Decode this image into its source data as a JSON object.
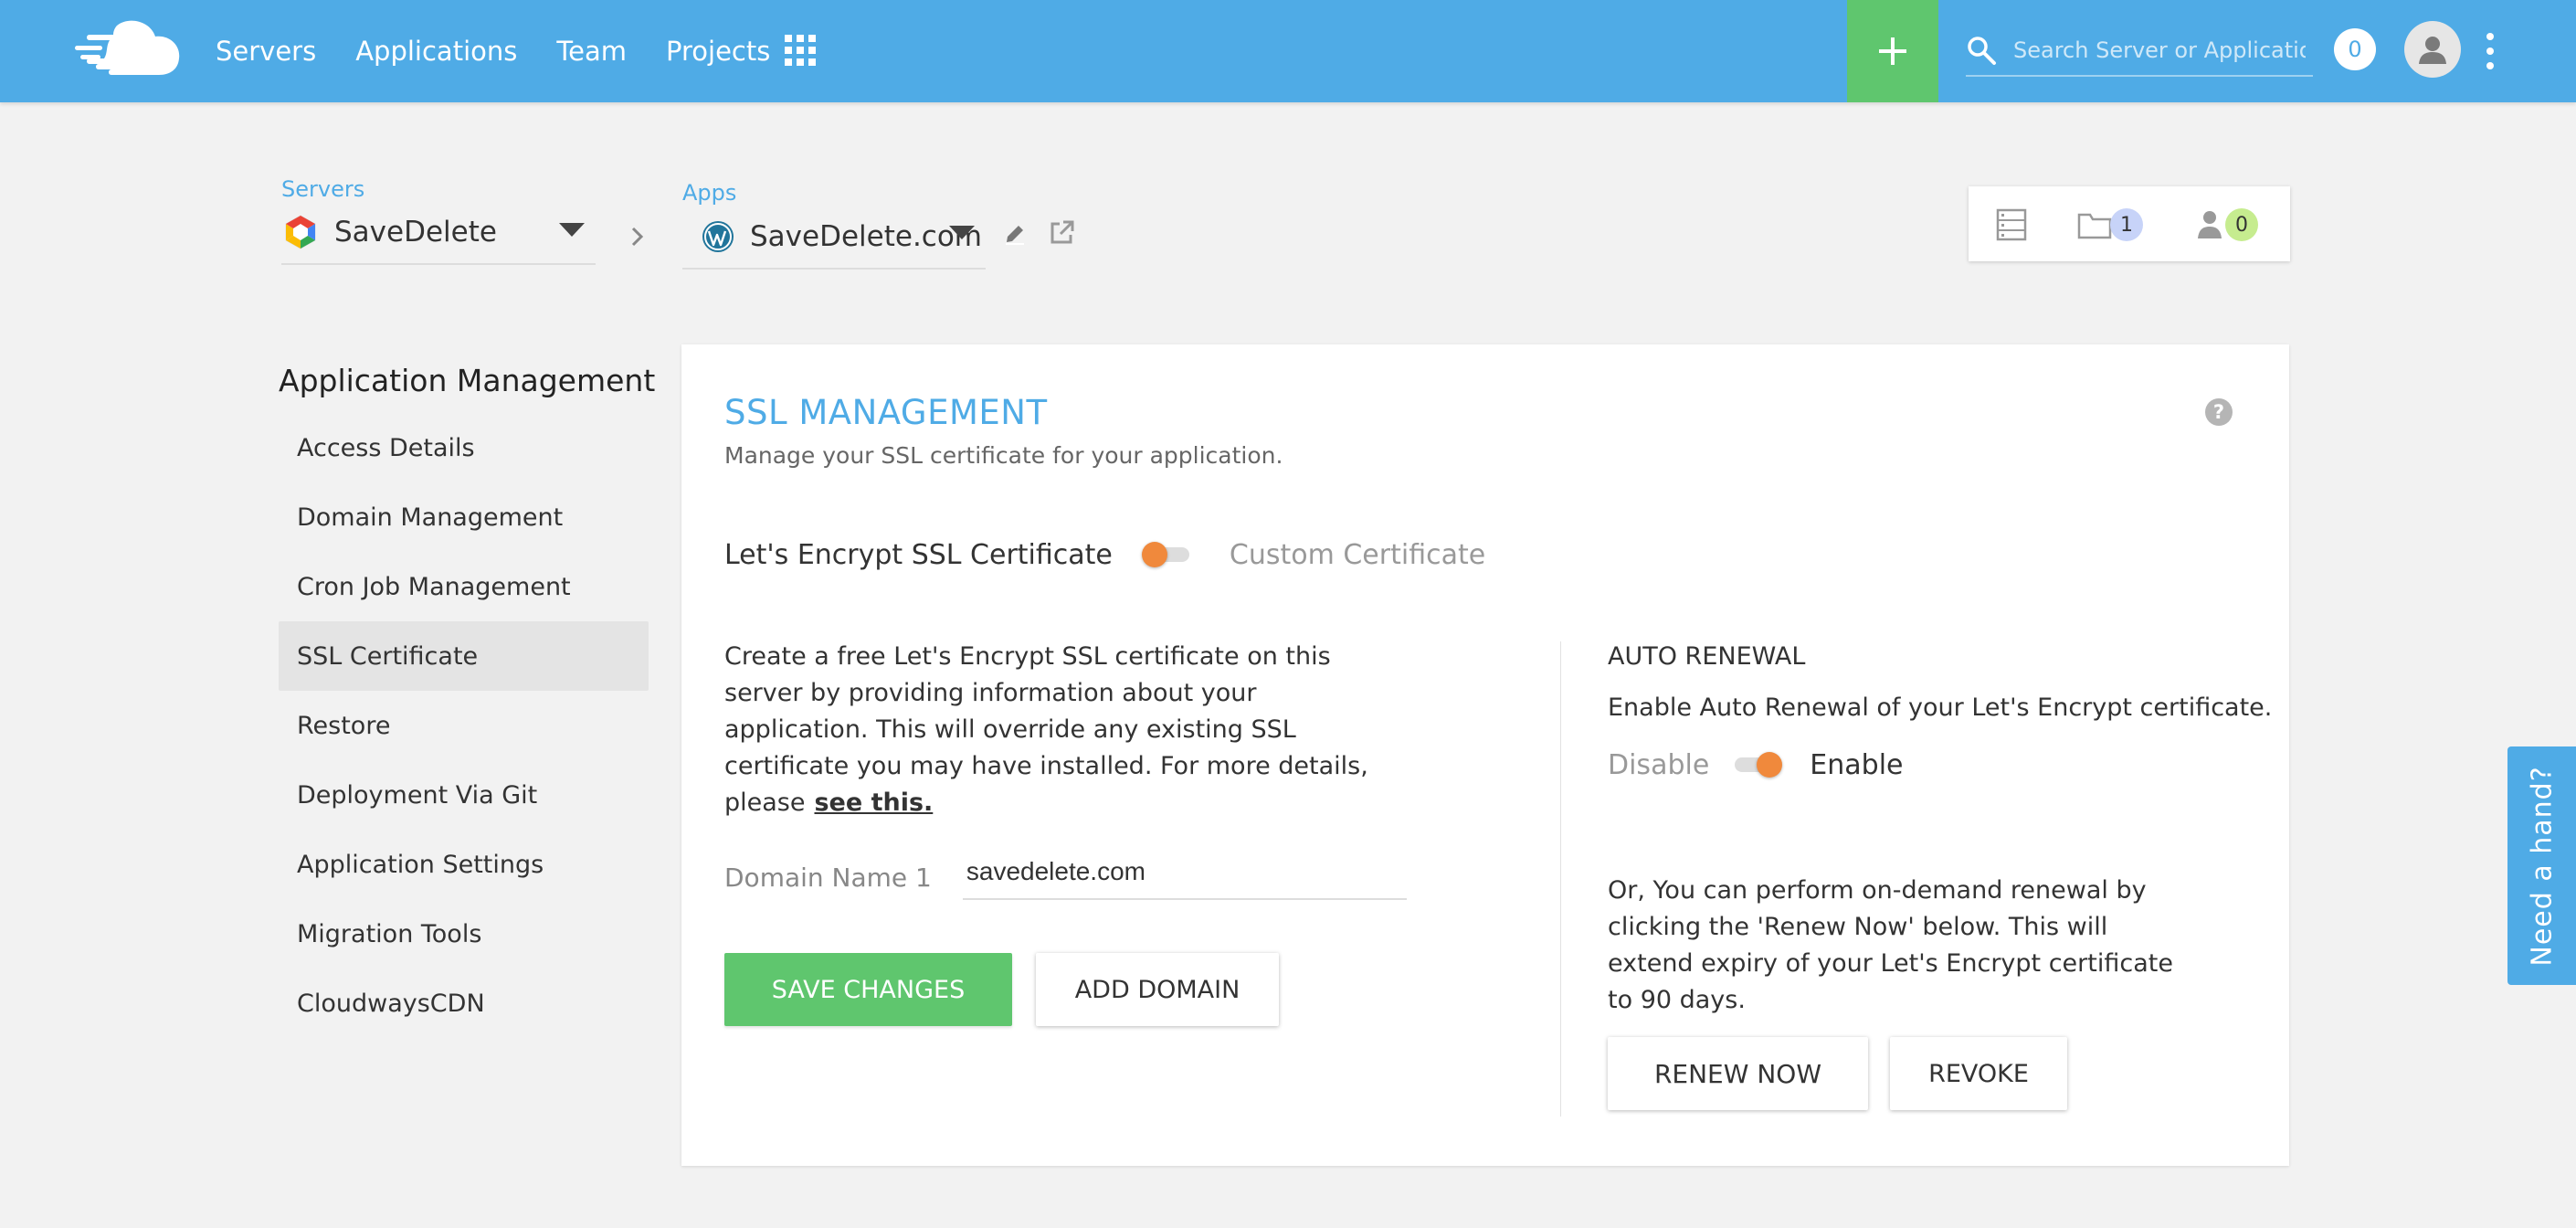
{
  "topbar": {
    "nav": [
      "Servers",
      "Applications",
      "Team",
      "Projects"
    ],
    "search_placeholder": "Search Server or Application",
    "notifications_count": "0"
  },
  "breadcrumb": {
    "servers_label": "Servers",
    "server_name": "SaveDelete",
    "apps_label": "Apps",
    "app_name": "SaveDelete.com"
  },
  "stats": {
    "folders_count": "1",
    "members_count": "0",
    "folders_color": "#c7d3f8",
    "members_color": "#c6ec8f"
  },
  "menu": {
    "title": "Application Management",
    "items": [
      "Access Details",
      "Domain Management",
      "Cron Job Management",
      "SSL Certificate",
      "Restore",
      "Deployment Via Git",
      "Application Settings",
      "Migration Tools",
      "CloudwaysCDN"
    ],
    "active_index": 3
  },
  "ssl": {
    "title": "SSL MANAGEMENT",
    "subtitle": "Manage your SSL certificate for your application.",
    "cert_option_on": "Let's Encrypt SSL Certificate",
    "cert_option_off": "Custom Certificate",
    "description": "Create a free Let's Encrypt SSL certificate on this server by providing information about your application. This will override any existing SSL certificate you may have installed. For more details, please",
    "see_this": "see this.",
    "domain_label": "Domain Name 1",
    "domain_value": "savedelete.com",
    "save_button": "SAVE CHANGES",
    "add_domain_button": "ADD DOMAIN"
  },
  "auto_renewal": {
    "title": "AUTO RENEWAL",
    "description": "Enable Auto Renewal of your Let's Encrypt certificate.",
    "disable_label": "Disable",
    "enable_label": "Enable",
    "note": "Or, You can perform on-demand renewal by clicking the 'Renew Now' below. This will extend expiry of your Let's Encrypt certificate to 90 days.",
    "renew_button": "RENEW NOW",
    "revoke_button": "REVOKE"
  },
  "help_widget": "Need a hand?",
  "colors": {
    "brand_blue": "#4fabe6",
    "success_green": "#5fc66e",
    "toggle_orange": "#f0893c"
  }
}
